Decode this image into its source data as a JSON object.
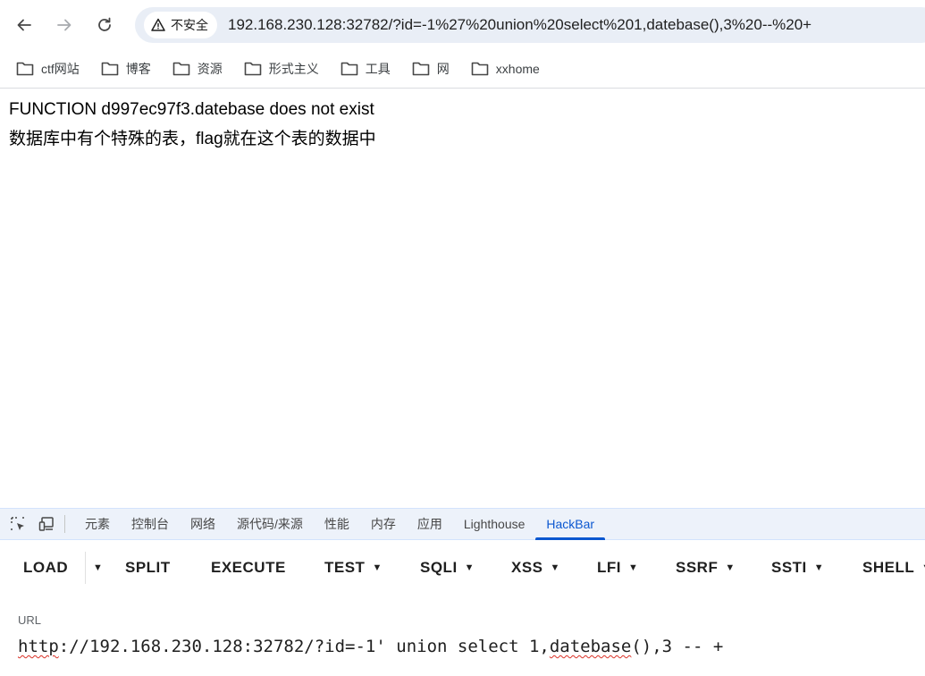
{
  "browser": {
    "security_label": "不安全",
    "url": "192.168.230.128:32782/?id=-1%27%20union%20select%201,datebase(),3%20--%20+"
  },
  "bookmarks": [
    {
      "label": "ctf网站",
      "icon": "folder-icon"
    },
    {
      "label": "博客",
      "icon": "folder-icon"
    },
    {
      "label": "资源",
      "icon": "folder-icon"
    },
    {
      "label": "形式主义",
      "icon": "folder-icon"
    },
    {
      "label": "工具",
      "icon": "folder-icon"
    },
    {
      "label": "网",
      "icon": "folder-icon"
    },
    {
      "label": "xxhome",
      "icon": "folder-icon"
    }
  ],
  "page": {
    "line1": "FUNCTION d997ec97f3.datebase does not exist",
    "line2": "数据库中有个特殊的表，flag就在这个表的数据中"
  },
  "devtools": {
    "tabs": [
      "元素",
      "控制台",
      "网络",
      "源代码/来源",
      "性能",
      "内存",
      "应用",
      "Lighthouse",
      "HackBar"
    ],
    "active_tab": "HackBar",
    "accent": "#0b57d0"
  },
  "hackbar": {
    "load": "LOAD",
    "split": "SPLIT",
    "execute": "EXECUTE",
    "test": "TEST",
    "sqli": "SQLI",
    "xss": "XSS",
    "lfi": "LFI",
    "ssrf": "SSRF",
    "ssti": "SSTI",
    "shell": "SHELL",
    "url_label": "URL",
    "url_parts": {
      "p1": "http",
      "p2": "://192.168.230.128:32782/?id=-1' union select 1,",
      "p3": "datebase",
      "p4": "(),3 -- +"
    }
  }
}
